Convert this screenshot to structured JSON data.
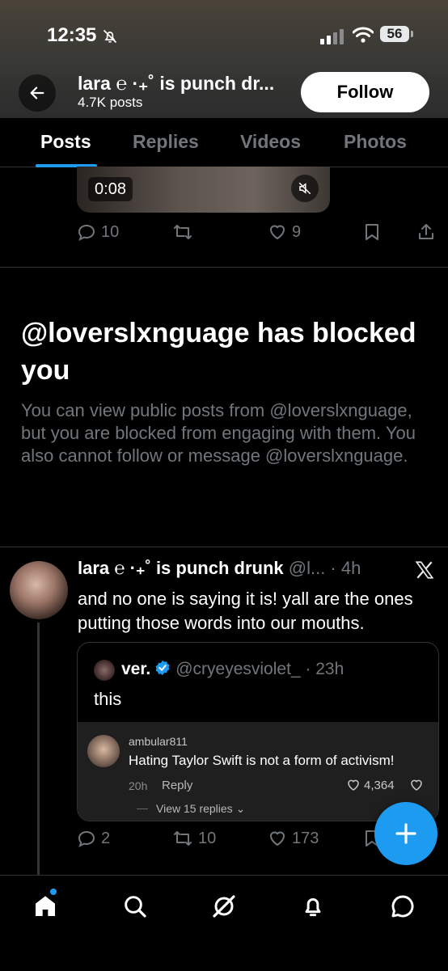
{
  "status_bar": {
    "time": "12:35",
    "battery": "56"
  },
  "header": {
    "title": "lara ℮ ·₊˚ is punch dr...",
    "posts_count": "4.7K posts",
    "follow_label": "Follow"
  },
  "tabs": [
    {
      "label": "Posts",
      "active": true
    },
    {
      "label": "Replies"
    },
    {
      "label": "Videos"
    },
    {
      "label": "Photos"
    }
  ],
  "media": {
    "duration": "0:08"
  },
  "post1_actions": {
    "replies": "10",
    "likes": "9"
  },
  "blocked": {
    "title": "@loverslxnguage has blocked you",
    "message": "You can view public posts from @loverslxnguage, but you are blocked from engaging with them. You also cannot follow or message @loverslxnguage."
  },
  "post2": {
    "name": "lara ℮ ·₊˚ is punch drunk",
    "meta": "@l... · 4h",
    "text": "and no one is saying it is! yall are the ones putting those words into our mouths.",
    "quote": {
      "name": "ver.",
      "meta": "@cryeyesviolet_ · 23h",
      "text": "this",
      "embed": {
        "username": "ambular811",
        "comment": "Hating Taylor Swift is not a form of activism!",
        "time": "20h",
        "reply_label": "Reply",
        "likes": "4,364",
        "view_replies": "View 15 replies"
      }
    },
    "actions": {
      "replies": "2",
      "reposts": "10",
      "likes": "173"
    }
  },
  "colors": {
    "accent": "#1d9bf0",
    "muted": "#71767b",
    "background": "#000000"
  },
  "icons": [
    "back-arrow-icon",
    "bell-slash-icon",
    "mute-icon",
    "reply-icon",
    "repost-icon",
    "heart-icon",
    "bookmark-icon",
    "share-icon",
    "x-logo-icon",
    "verified-icon",
    "compose-icon",
    "home-icon",
    "search-icon",
    "grok-icon",
    "notifications-icon",
    "messages-icon"
  ]
}
